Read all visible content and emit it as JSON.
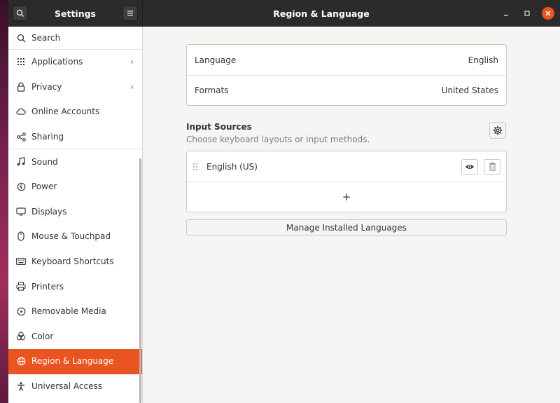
{
  "headerbar": {
    "app_title": "Settings",
    "page_title": "Region & Language"
  },
  "sidebar": {
    "items": [
      {
        "label": "Search",
        "icon": "search-icon"
      },
      {
        "label": "Applications",
        "icon": "grid-icon",
        "has_chevron": true
      },
      {
        "label": "Privacy",
        "icon": "lock-icon",
        "has_chevron": true
      },
      {
        "label": "Online Accounts",
        "icon": "cloud-icon"
      },
      {
        "label": "Sharing",
        "icon": "share-icon"
      },
      {
        "label": "Sound",
        "icon": "music-note-icon"
      },
      {
        "label": "Power",
        "icon": "power-icon"
      },
      {
        "label": "Displays",
        "icon": "display-icon"
      },
      {
        "label": "Mouse & Touchpad",
        "icon": "mouse-icon"
      },
      {
        "label": "Keyboard Shortcuts",
        "icon": "keyboard-icon"
      },
      {
        "label": "Printers",
        "icon": "printer-icon"
      },
      {
        "label": "Removable Media",
        "icon": "removable-media-icon"
      },
      {
        "label": "Color",
        "icon": "color-icon"
      },
      {
        "label": "Region & Language",
        "icon": "globe-icon",
        "active": true
      },
      {
        "label": "Universal Access",
        "icon": "accessibility-icon"
      }
    ],
    "chevron": "›"
  },
  "region": {
    "language_label": "Language",
    "language_value": "English",
    "formats_label": "Formats",
    "formats_value": "United States"
  },
  "input_sources": {
    "title": "Input Sources",
    "subtitle": "Choose keyboard layouts or input methods.",
    "sources": [
      {
        "name": "English (US)"
      }
    ],
    "add_label": "+"
  },
  "manage_button_label": "Manage Installed Languages",
  "colors": {
    "accent": "#e95420",
    "headerbar": "#2b2b2b",
    "sidebar_bg": "#ffffff",
    "content_bg": "#f6f5f4"
  }
}
